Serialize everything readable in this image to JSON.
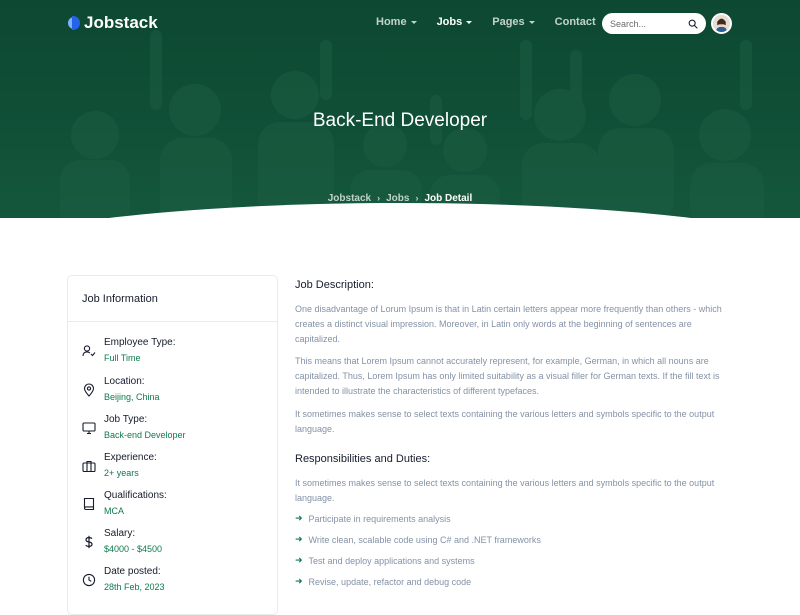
{
  "brand": {
    "name": "Jobstack"
  },
  "nav": {
    "items": [
      {
        "label": "Home",
        "dropdown": true,
        "active": false
      },
      {
        "label": "Jobs",
        "dropdown": true,
        "active": true
      },
      {
        "label": "Pages",
        "dropdown": true,
        "active": false
      },
      {
        "label": "Contact",
        "dropdown": false,
        "active": false
      }
    ],
    "search_placeholder": "Search..."
  },
  "hero": {
    "title": "Back-End Developer",
    "breadcrumb": [
      "Jobstack",
      "Jobs",
      "Job Detail"
    ]
  },
  "sidebar": {
    "title": "Job Information",
    "items": [
      {
        "label": "Employee Type:",
        "value": "Full Time",
        "icon": "user-check-icon"
      },
      {
        "label": "Location:",
        "value": "Beijing, China",
        "icon": "map-pin-icon"
      },
      {
        "label": "Job Type:",
        "value": "Back-end Developer",
        "icon": "monitor-icon"
      },
      {
        "label": "Experience:",
        "value": "2+ years",
        "icon": "briefcase-icon"
      },
      {
        "label": "Qualifications:",
        "value": "MCA",
        "icon": "book-icon"
      },
      {
        "label": "Salary:",
        "value": "$4000 - $4500",
        "icon": "dollar-icon"
      },
      {
        "label": "Date posted:",
        "value": "28th Feb, 2023",
        "icon": "clock-icon"
      }
    ]
  },
  "content": {
    "description_heading": "Job Description:",
    "paragraphs": [
      "One disadvantage of Lorum Ipsum is that in Latin certain letters appear more frequently than others - which creates a distinct visual impression. Moreover, in Latin only words at the beginning of sentences are capitalized.",
      "This means that Lorem Ipsum cannot accurately represent, for example, German, in which all nouns are capitalized. Thus, Lorem Ipsum has only limited suitability as a visual filler for German texts. If the fill text is intended to illustrate the characteristics of different typefaces.",
      "It sometimes makes sense to select texts containing the various letters and symbols specific to the output language."
    ],
    "responsibilities_heading": "Responsibilities and Duties:",
    "responsibilities_intro": "It sometimes makes sense to select texts containing the various letters and symbols specific to the output language.",
    "duties": [
      "Participate in requirements analysis",
      "Write clean, scalable code using C# and .NET frameworks",
      "Test and deploy applications and systems",
      "Revise, update, refactor and debug code"
    ]
  },
  "colors": {
    "primary_green": "#0f7a4d",
    "hero_green": "#155c40",
    "heading": "#161c2d",
    "muted_text": "#8492a6"
  }
}
